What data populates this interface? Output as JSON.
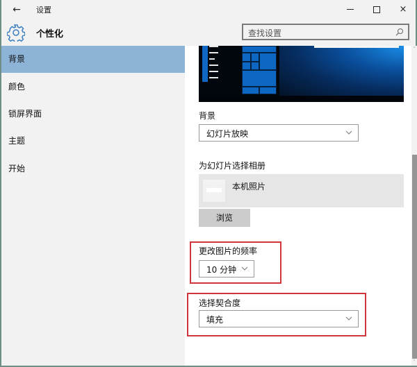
{
  "window": {
    "title": "设置",
    "back_icon": "←",
    "controls": {
      "minimize": "minimize-icon",
      "maximize": "maximize-icon",
      "close": "×"
    }
  },
  "header": {
    "icon": "gear-icon",
    "page_title": "个性化",
    "search": {
      "placeholder": "查找设置",
      "value": "",
      "icon": "search-icon"
    }
  },
  "sidebar": {
    "items": [
      {
        "label": "背景",
        "active": true
      },
      {
        "label": "颜色",
        "active": false
      },
      {
        "label": "锁屏界面",
        "active": false
      },
      {
        "label": "主题",
        "active": false
      },
      {
        "label": "开始",
        "active": false
      }
    ]
  },
  "main": {
    "background": {
      "label": "背景",
      "value": "幻灯片放映"
    },
    "album": {
      "label": "为幻灯片选择相册",
      "item": "本机照片",
      "browse_label": "浏览"
    },
    "frequency": {
      "label": "更改图片的频率",
      "value": "10 分钟"
    },
    "fit": {
      "label": "选择契合度",
      "value": "填充"
    }
  },
  "scrollbar": {
    "up": "˄",
    "down": "˅"
  },
  "colors": {
    "accent": "#8db4d6",
    "highlight_box": "#d0353b",
    "tile_blue": "#0f67c4"
  }
}
